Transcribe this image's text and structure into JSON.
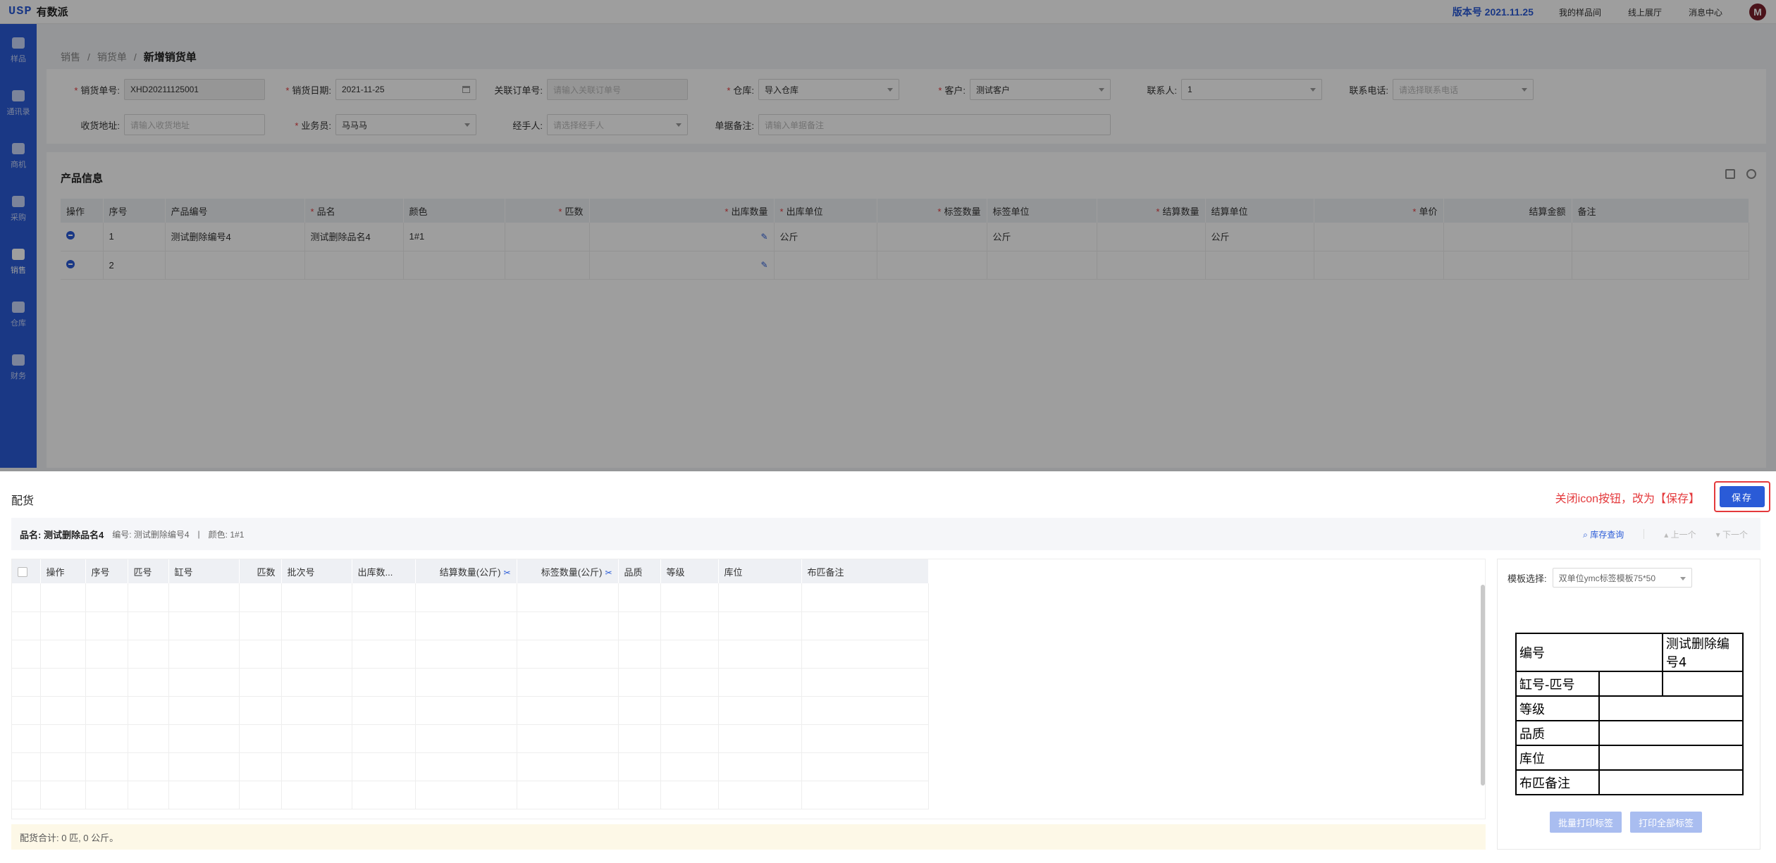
{
  "app": {
    "logo_mark": "USP",
    "logo_text": "有数派",
    "version": "版本号 2021.11.25",
    "links": [
      "我的样品间",
      "线上展厅",
      "消息中心"
    ],
    "avatar_letter": "M"
  },
  "sidebar": {
    "items": [
      {
        "label": "样品"
      },
      {
        "label": "通讯录"
      },
      {
        "label": "商机"
      },
      {
        "label": "采购"
      },
      {
        "label": "销售"
      },
      {
        "label": "仓库"
      },
      {
        "label": "财务"
      }
    ]
  },
  "breadcrumb": {
    "items": [
      "销售",
      "销货单"
    ],
    "current": "新增销货单",
    "sep": "/"
  },
  "form": {
    "sale_no_label": "销货单号:",
    "sale_no": "XHD20211125001",
    "sale_date_label": "销货日期:",
    "sale_date": "2021-11-25",
    "order_label": "关联订单号:",
    "order_ph": "请输入关联订单号",
    "warehouse_label": "仓库:",
    "warehouse": "导入仓库",
    "customer_label": "客户:",
    "customer": "测试客户",
    "contact_label": "联系人:",
    "contact": "1",
    "phone_label": "联系电话:",
    "phone_ph": "请选择联系电话",
    "address_label": "收货地址:",
    "address_ph": "请输入收货地址",
    "salesman_label": "业务员:",
    "salesman": "马马马",
    "handler_label": "经手人:",
    "handler_ph": "请选择经手人",
    "remark_label": "单据备注:",
    "remark_ph": "请输入单据备注"
  },
  "product": {
    "title": "产品信息",
    "headers": [
      "操作",
      "序号",
      "产品编号",
      "品名",
      "颜色",
      "匹数",
      "出库数量",
      "出库单位",
      "标签数量",
      "标签单位",
      "结算数量",
      "结算单位",
      "单价",
      "结算金额",
      "备注"
    ],
    "rows": [
      [
        "",
        "1",
        "测试删除编号4",
        "测试删除品名4",
        "1#1",
        "",
        "",
        "公斤",
        "",
        "公斤",
        "",
        "公斤",
        "",
        "",
        ""
      ],
      [
        "",
        "2",
        "",
        "",
        "",
        "",
        "",
        "",
        "",
        "",
        "",
        "",
        "",
        "",
        ""
      ]
    ]
  },
  "drawer": {
    "title": "配货",
    "annotation": "关闭icon按钮，改为【保存】",
    "save": "保存",
    "info_name_label": "品名:",
    "info_name": "测试删除品名4",
    "info_code": "编号: 测试删除编号4",
    "info_divider": "|",
    "info_color": "颜色: 1#1",
    "stock_query": "库存查询",
    "prev": "上一个",
    "next": "下一个",
    "alloc_headers": [
      "操作",
      "序号",
      "匹号",
      "缸号",
      "匹数",
      "批次号",
      "出库数...",
      "结算数量(公斤)",
      "标签数量(公斤)",
      "品质",
      "等级",
      "库位",
      "布匹备注"
    ],
    "summary": "配货合计: 0 匹, 0 公斤。",
    "template_label": "模板选择:",
    "template": "双单位ymc标签模板75*50",
    "label_rows": [
      {
        "k": "编号",
        "v": "测试删除编号4"
      },
      {
        "k": "缸号-匹号",
        "v": ""
      },
      {
        "k": "等级",
        "v": ""
      },
      {
        "k": "品质",
        "v": ""
      },
      {
        "k": "库位",
        "v": ""
      },
      {
        "k": "布匹备注",
        "v": ""
      }
    ],
    "btn_batch": "批量打印标签",
    "btn_all": "打印全部标签"
  },
  "colors": {
    "primary": "#2a5bd7",
    "danger": "#e4393c"
  }
}
